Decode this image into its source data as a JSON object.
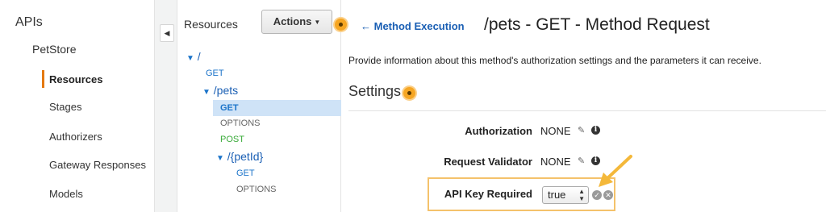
{
  "leftnav": {
    "apis": "APIs",
    "api_name": "PetStore",
    "items": [
      {
        "label": "Resources",
        "active": true
      },
      {
        "label": "Stages"
      },
      {
        "label": "Authorizers"
      },
      {
        "label": "Gateway Responses"
      },
      {
        "label": "Models"
      }
    ]
  },
  "collapse": {
    "icon": "◀"
  },
  "resources": {
    "title": "Resources",
    "actions_label": "Actions",
    "tree": {
      "root": "/",
      "root_get": "GET",
      "pets": "/pets",
      "pets_methods": [
        "GET",
        "OPTIONS",
        "POST"
      ],
      "petid": "/{petId}",
      "petid_methods": [
        "GET",
        "OPTIONS"
      ]
    }
  },
  "main": {
    "back_link": "Method Execution",
    "back_arrow": "←",
    "title": "/pets - GET - Method Request",
    "description": "Provide information about this method's authorization settings and the parameters it can receive.",
    "settings_heading": "Settings",
    "rows": [
      {
        "label": "Authorization",
        "value": "NONE"
      },
      {
        "label": "Request Validator",
        "value": "NONE"
      },
      {
        "label": "API Key Required",
        "value": "true"
      }
    ]
  },
  "colors": {
    "accent": "#e47911",
    "link": "#1a5fb4",
    "highlight": "#f4c26b"
  }
}
